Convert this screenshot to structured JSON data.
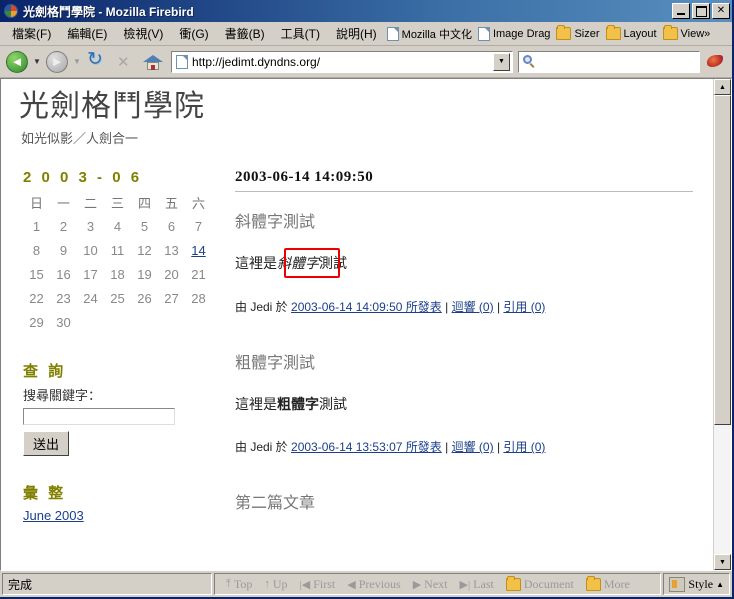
{
  "window": {
    "title": "光劍格鬥學院 - Mozilla Firebird",
    "app_icon": "firebird-icon",
    "minimize_label": "_",
    "maximize_label": "□",
    "close_label": "✕"
  },
  "menubar": {
    "items": [
      {
        "label": "檔案(F)"
      },
      {
        "label": "編輯(E)"
      },
      {
        "label": "檢視(V)"
      },
      {
        "label": "衝(G)"
      },
      {
        "label": "書籤(B)"
      },
      {
        "label": "工具(T)"
      },
      {
        "label": "說明(H)"
      }
    ],
    "bookmarks": [
      {
        "label": "Mozilla 中文化",
        "icon": "page-icon"
      },
      {
        "label": "Image Drag",
        "icon": "page-icon"
      },
      {
        "label": "Sizer",
        "icon": "folder-icon"
      },
      {
        "label": "Layout",
        "icon": "folder-icon"
      },
      {
        "label": "View»",
        "icon": "folder-icon"
      }
    ]
  },
  "navbar": {
    "back": {
      "glyph": "◄",
      "name": "back-button"
    },
    "forward": {
      "glyph": "►",
      "name": "forward-button"
    },
    "reload": {
      "name": "reload-button"
    },
    "stop": {
      "name": "stop-button"
    },
    "home": {
      "name": "home-button"
    },
    "url": "http://jedimt.dyndns.org/",
    "url_placeholder": "",
    "search_value": "",
    "search_placeholder": "",
    "dropdown_caret": "▼"
  },
  "page": {
    "site_title": "光劍格鬥學院",
    "site_description": "如光似影／人劍合一",
    "sidebar": {
      "calendar": {
        "heading": "2 0 0 3 - 0 6",
        "weekdays": [
          "日",
          "一",
          "二",
          "三",
          "四",
          "五",
          "六"
        ],
        "weeks": [
          [
            "1",
            "2",
            "3",
            "4",
            "5",
            "6",
            "7"
          ],
          [
            "8",
            "9",
            "10",
            "11",
            "12",
            "13",
            "14"
          ],
          [
            "15",
            "16",
            "17",
            "18",
            "19",
            "20",
            "21"
          ],
          [
            "22",
            "23",
            "24",
            "25",
            "26",
            "27",
            "28"
          ],
          [
            "29",
            "30",
            "",
            "",
            "",
            "",
            ""
          ]
        ],
        "linked_days": [
          "14"
        ]
      },
      "search": {
        "heading": "查 詢",
        "label": "搜尋關鍵字：",
        "value": "",
        "placeholder": "",
        "submit_label": "送出"
      },
      "archives": {
        "heading": "彙 整",
        "links": [
          "June 2003"
        ]
      }
    },
    "posts": [
      {
        "date_header": "2003-06-14 14:09:50",
        "title": "斜體字測試",
        "body_prefix": "這裡是",
        "body_emph": "斜體字",
        "body_suffix": "測試",
        "emph_style": "italic",
        "annotated": true,
        "footer": {
          "by_prefix": "由 Jedi 於 ",
          "date_link": "2003-06-14 14:09:50 所發表",
          "sep": " | ",
          "comments_link": "迴響 (0)",
          "trackback_link": "引用 (0)"
        }
      },
      {
        "date_header": "",
        "title": "粗體字測試",
        "body_prefix": "這裡是",
        "body_emph": "粗體字",
        "body_suffix": "測試",
        "emph_style": "bold",
        "annotated": false,
        "footer": {
          "by_prefix": "由 Jedi 於 ",
          "date_link": "2003-06-14 13:53:07 所發表",
          "sep": " | ",
          "comments_link": "迴響 (0)",
          "trackback_link": "引用 (0)"
        }
      },
      {
        "date_header": "",
        "title": "第二篇文章",
        "body_prefix": "",
        "body_emph": "",
        "body_suffix": "",
        "emph_style": "none",
        "annotated": false
      }
    ]
  },
  "statusbar": {
    "status_text": "完成",
    "sitenav": [
      {
        "label": "Top",
        "icon": "arrow-top-icon",
        "glyph": "⤒"
      },
      {
        "label": "Up",
        "icon": "arrow-up-icon",
        "glyph": "↑"
      },
      {
        "label": "First",
        "icon": "first-icon",
        "glyph": "|◀"
      },
      {
        "label": "Previous",
        "icon": "previous-icon",
        "glyph": "◀"
      },
      {
        "label": "Next",
        "icon": "next-icon",
        "glyph": "▶"
      },
      {
        "label": "Last",
        "icon": "last-icon",
        "glyph": "▶|"
      },
      {
        "label": "Document",
        "icon": "folder-icon",
        "glyph": ""
      },
      {
        "label": "More",
        "icon": "folder-icon",
        "glyph": ""
      }
    ],
    "style": {
      "label": "Style",
      "caret": "▲",
      "icon": "style-icon"
    }
  },
  "colors": {
    "titlebar_start": "#0a246a",
    "chrome": "#d4d0c8",
    "link": "#1b3f8b",
    "heading_olive": "#808000",
    "annotation_red": "#ee0000",
    "page_bg": "#ffffff"
  }
}
